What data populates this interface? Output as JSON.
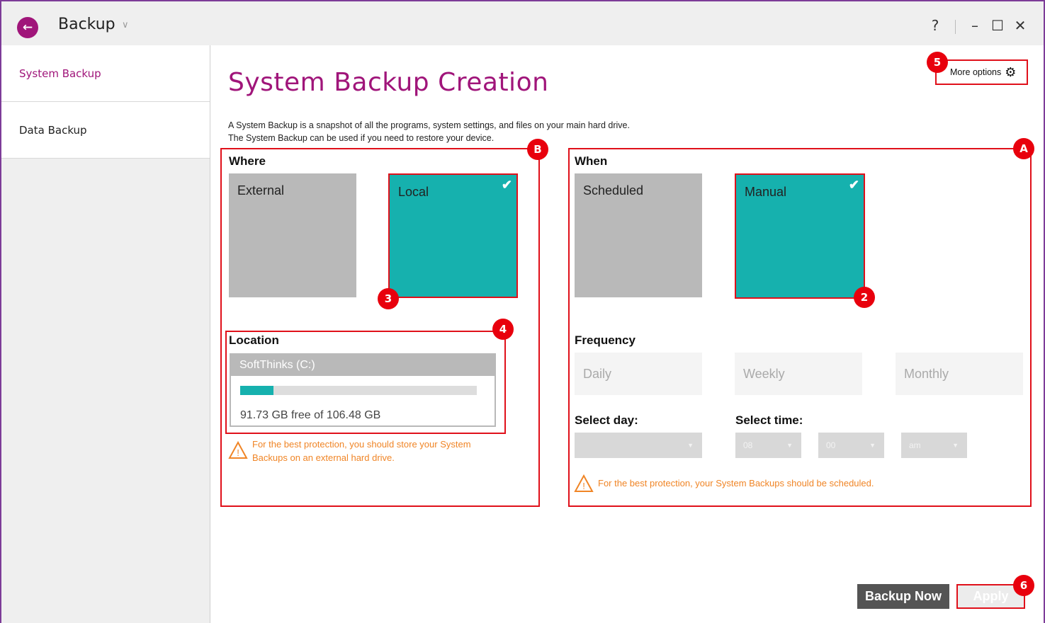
{
  "window": {
    "title": "Backup",
    "help_label": "?",
    "minimize_label": "–",
    "maximize_label": "☐",
    "close_label": "✕"
  },
  "sidebar": {
    "items": [
      {
        "label": "System Backup",
        "active": true
      },
      {
        "label": "Data Backup",
        "active": false
      }
    ]
  },
  "main": {
    "title": "System Backup Creation",
    "description_line1": "A System Backup is a snapshot of all the programs, system settings, and files on your main hard drive.",
    "description_line2": "The System Backup can be used if you need to restore your device.",
    "more_options_label": "More options"
  },
  "where": {
    "label": "Where",
    "options": [
      {
        "label": "External",
        "selected": false
      },
      {
        "label": "Local",
        "selected": true
      }
    ]
  },
  "location": {
    "label": "Location",
    "drive_name": "SoftThinks (C:)",
    "usage_fraction": 0.14,
    "free_text": "91.73 GB free of 106.48 GB",
    "warning": "For the best protection, you should store your System Backups on an external hard drive."
  },
  "when": {
    "label": "When",
    "options": [
      {
        "label": "Scheduled",
        "selected": false
      },
      {
        "label": "Manual",
        "selected": true
      }
    ],
    "frequency_label": "Frequency",
    "frequency_options": [
      "Daily",
      "Weekly",
      "Monthly"
    ],
    "select_day_label": "Select day:",
    "select_time_label": "Select time:",
    "day_value": "",
    "hour_value": "08",
    "minute_value": "00",
    "ampm_value": "am",
    "warning": "For the best protection, your System Backups should be scheduled."
  },
  "annotations": {
    "badges": [
      "A",
      "B",
      "2",
      "3",
      "4",
      "5",
      "6"
    ]
  },
  "actions": {
    "backup_now_label": "Backup Now",
    "apply_label": "Apply"
  },
  "colors": {
    "accent": "#a0157a",
    "teal": "#16b1ae",
    "annotation_red": "#e0101a",
    "warning_orange": "#f08526"
  }
}
